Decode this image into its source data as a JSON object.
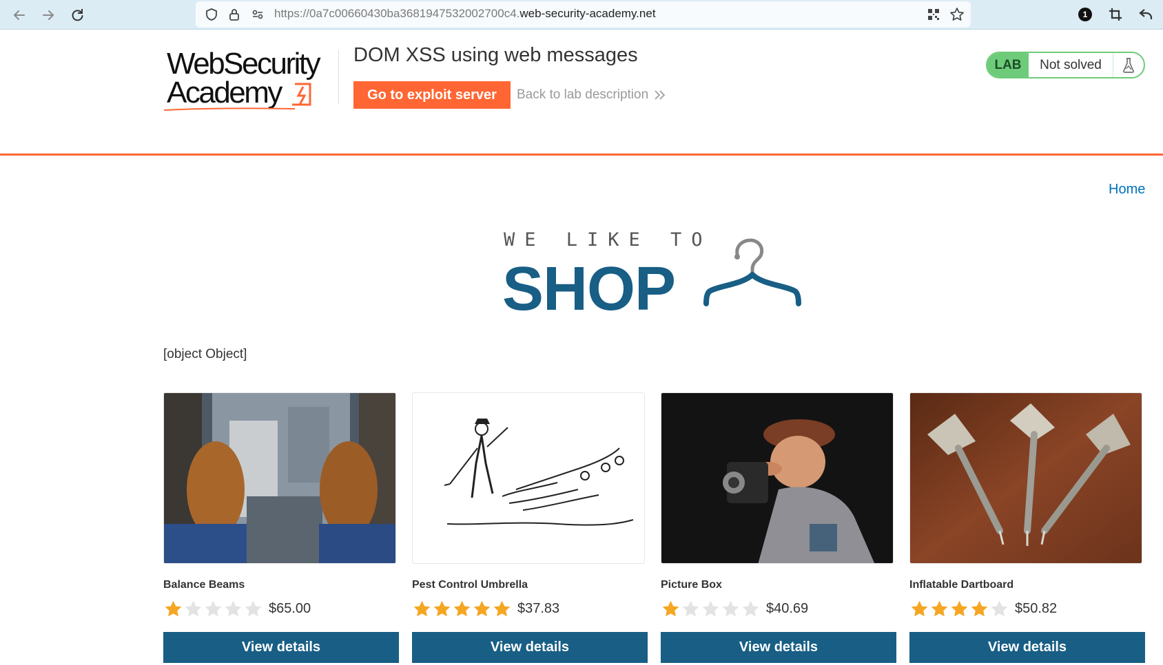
{
  "browser": {
    "url_prefix": "https://0a7c00660430ba3681947532002700c4.",
    "url_domain": "web-security-academy.net",
    "notification_count": "1"
  },
  "lab": {
    "logo_line1": "WebSecurity",
    "logo_line2": "Academy",
    "title": "DOM XSS using web messages",
    "exploit_button": "Go to exploit server",
    "back_link": "Back to lab description",
    "badge": "LAB",
    "status": "Not solved",
    "accent_color": "#ff6633",
    "status_color": "#6ecb7a"
  },
  "shop": {
    "home_link": "Home",
    "banner_top": "WE LIKE TO",
    "banner_main": "SHOP",
    "injected_text": "[object Object]",
    "brand_color": "#185e85",
    "products": [
      {
        "name": "Balance Beams",
        "rating": 1,
        "max_rating": 5,
        "price": "$65.00",
        "button": "View details",
        "image": "feet-over-city-photo"
      },
      {
        "name": "Pest Control Umbrella",
        "rating": 5,
        "max_rating": 5,
        "price": "$37.83",
        "button": "View details",
        "image": "umbrella-sketch"
      },
      {
        "name": "Picture Box",
        "rating": 1,
        "max_rating": 5,
        "price": "$40.69",
        "button": "View details",
        "image": "photographer-figurine"
      },
      {
        "name": "Inflatable Dartboard",
        "rating": 4,
        "max_rating": 5,
        "price": "$50.82",
        "button": "View details",
        "image": "darts-photo"
      }
    ]
  }
}
